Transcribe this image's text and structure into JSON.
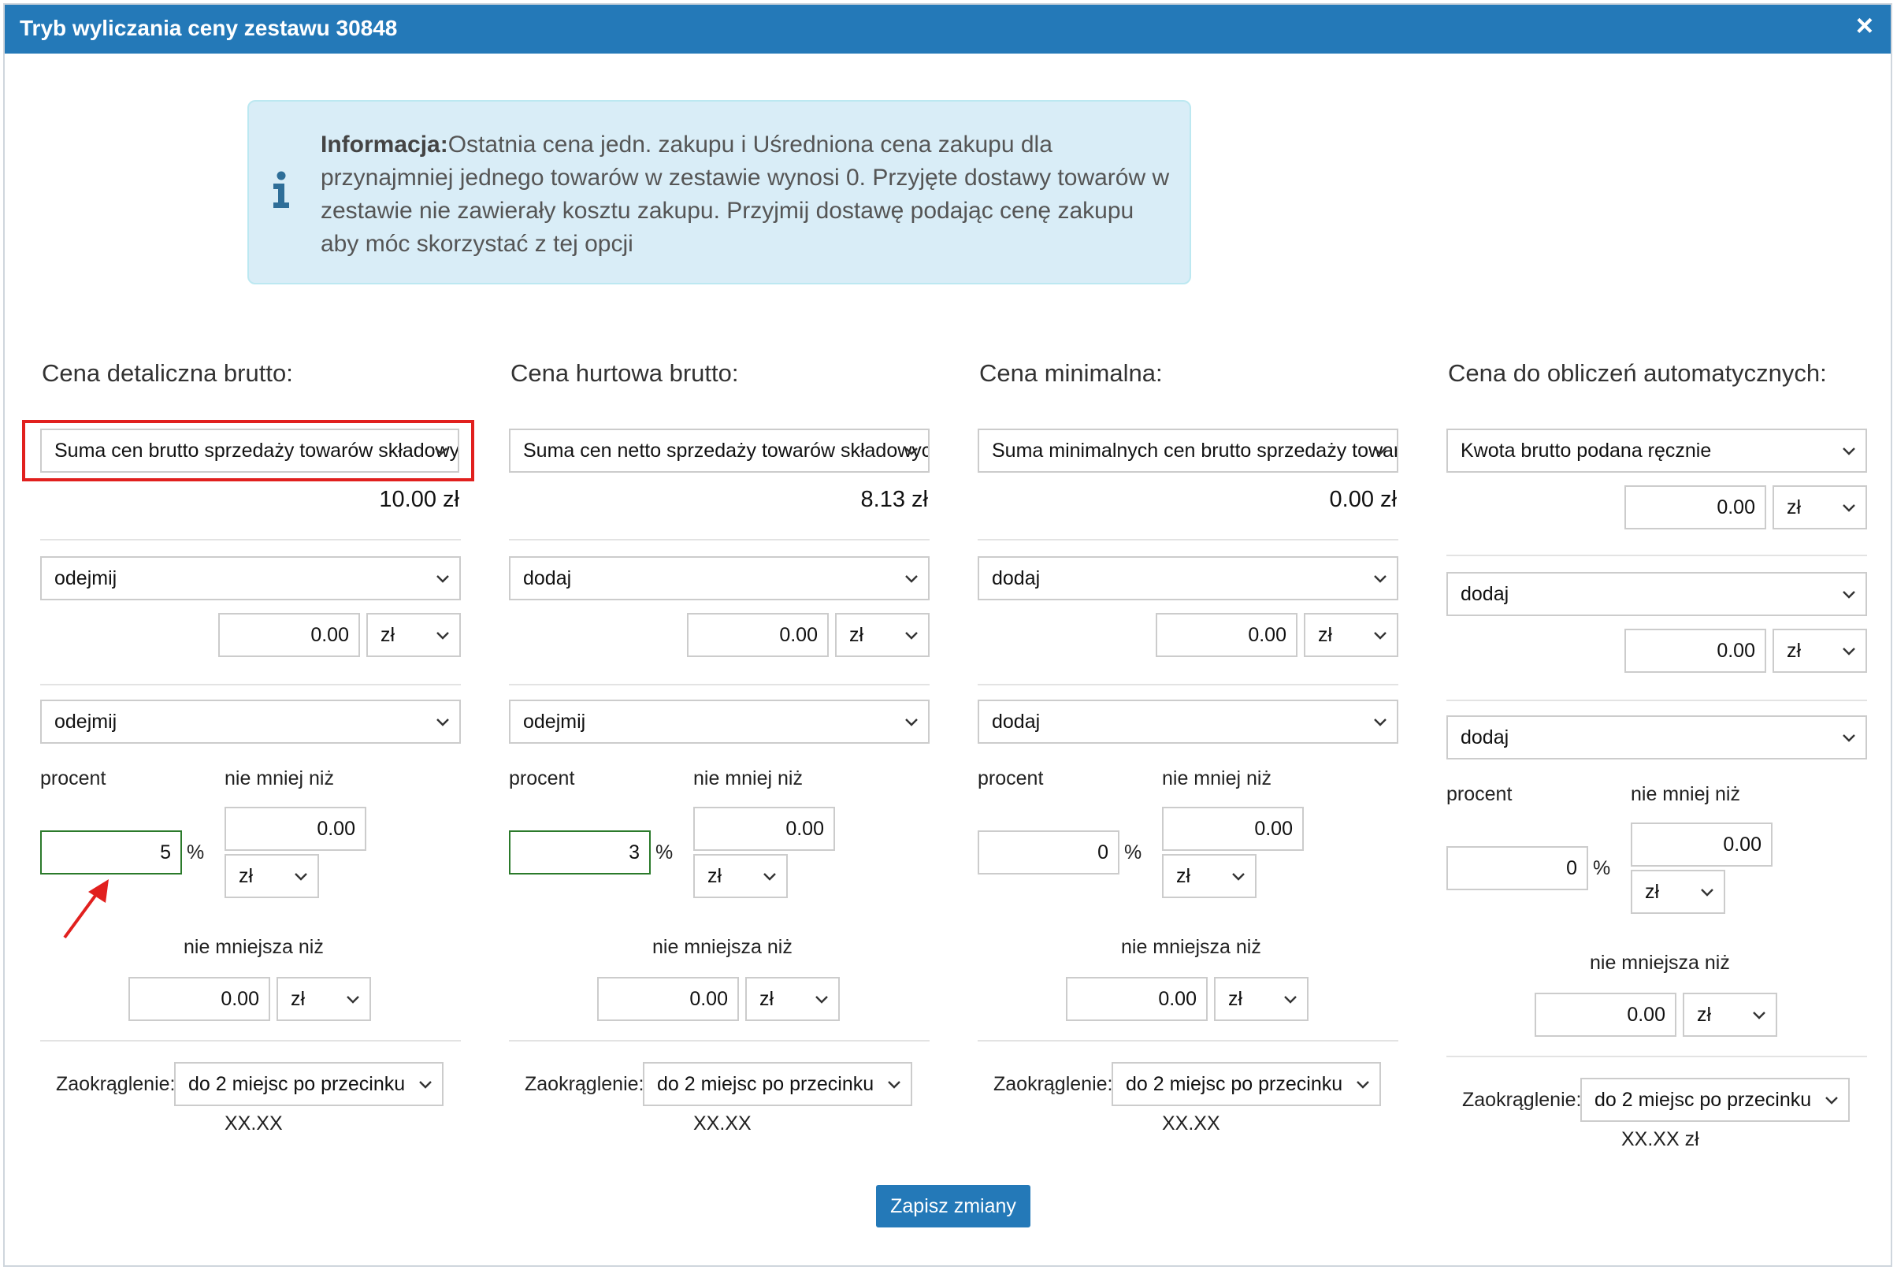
{
  "dialog": {
    "title": "Tryb wyliczania ceny zestawu 30848",
    "close": "×"
  },
  "info": {
    "label": "Informacja:",
    "text": "Ostatnia cena jedn. zakupu i Uśredniona cena zakupu dla przynajmniej jednego towarów w zestawie wynosi 0. Przyjęte dostawy towarów w zestawie nie zawierały kosztu zakupu. Przyjmij dostawę podając cenę zakupu aby móc skorzystać z tej opcji"
  },
  "columns": [
    {
      "heading": "Cena detaliczna brutto:",
      "base_select": "Suma cen brutto sprzedaży towarów składowych",
      "amount": "10.00 zł",
      "op1": "odejmij",
      "op1_value": "0.00",
      "op1_unit": "zł",
      "op2": "odejmij",
      "percent_label": "procent",
      "percent_value": "5",
      "percent_sign": "%",
      "min_label": "nie mniej niż",
      "min_value": "0.00",
      "min_unit": "zł",
      "min2_label": "nie mniejsza niż",
      "min2_value": "0.00",
      "min2_unit": "zł",
      "round_label": "Zaokrąglenie:",
      "round_select": "do 2 miejsc po przecinku",
      "round_format": "XX.XX"
    },
    {
      "heading": "Cena hurtowa brutto:",
      "base_select": "Suma cen netto sprzedaży towarów składowych",
      "amount": "8.13 zł",
      "op1": "dodaj",
      "op1_value": "0.00",
      "op1_unit": "zł",
      "op2": "odejmij",
      "percent_label": "procent",
      "percent_value": "3",
      "percent_sign": "%",
      "min_label": "nie mniej niż",
      "min_value": "0.00",
      "min_unit": "zł",
      "min2_label": "nie mniejsza niż",
      "min2_value": "0.00",
      "min2_unit": "zł",
      "round_label": "Zaokrąglenie:",
      "round_select": "do 2 miejsc po przecinku",
      "round_format": "XX.XX"
    },
    {
      "heading": "Cena minimalna:",
      "base_select": "Suma minimalnych cen brutto sprzedaży towarów",
      "amount": "0.00 zł",
      "op1": "dodaj",
      "op1_value": "0.00",
      "op1_unit": "zł",
      "op2": "dodaj",
      "percent_label": "procent",
      "percent_value": "0",
      "percent_sign": "%",
      "min_label": "nie mniej niż",
      "min_value": "0.00",
      "min_unit": "zł",
      "min2_label": "nie mniejsza niż",
      "min2_value": "0.00",
      "min2_unit": "zł",
      "round_label": "Zaokrąglenie:",
      "round_select": "do 2 miejsc po przecinku",
      "round_format": "XX.XX"
    },
    {
      "heading": "Cena do obliczeń automatycznych:",
      "base_select": "Kwota brutto podana ręcznie",
      "manual_value": "0.00",
      "manual_unit": "zł",
      "op1": "dodaj",
      "op1_value": "0.00",
      "op1_unit": "zł",
      "op2": "dodaj",
      "percent_label": "procent",
      "percent_value": "0",
      "percent_sign": "%",
      "min_label": "nie mniej niż",
      "min_value": "0.00",
      "min_unit": "zł",
      "min2_label": "nie mniejsza niż",
      "min2_value": "0.00",
      "min2_unit": "zł",
      "round_label": "Zaokrąglenie:",
      "round_select": "do 2 miejsc po przecinku",
      "round_format": "XX.XX zł"
    }
  ],
  "save_button": "Zapisz zmiany",
  "colors": {
    "header": "#2479b8",
    "info_bg": "#d9edf7",
    "highlight": "#e1201e",
    "focus_border": "#2b7a2b"
  }
}
